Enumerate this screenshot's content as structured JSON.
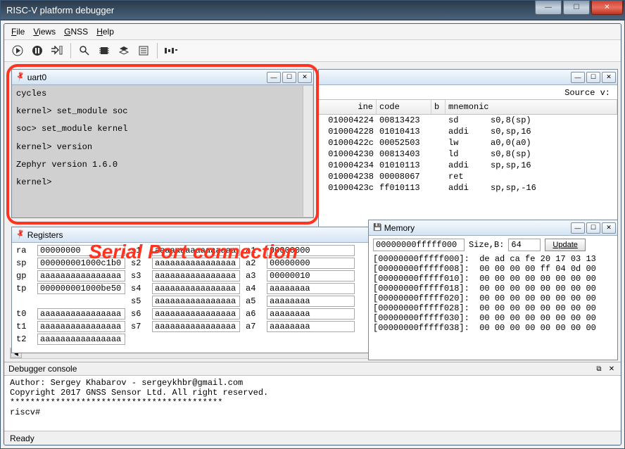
{
  "window": {
    "title": "RISC-V platform debugger"
  },
  "menu": {
    "file": "File",
    "views": "Views",
    "gnss": "GNSS",
    "help": "Help"
  },
  "toolbar_icons": {
    "play": "play-icon",
    "pause": "pause-icon",
    "step": "step-icon",
    "zoom": "search-icon",
    "cpu": "cpu-icon",
    "layers": "layers-icon",
    "list": "list-icon",
    "signal": "signal-icon"
  },
  "uart": {
    "title": "uart0",
    "lines": [
      "cycles",
      "",
      "kernel> set_module soc",
      "",
      "soc> set_module kernel",
      "",
      "kernel> version",
      "",
      "Zephyr version 1.6.0",
      "",
      "kernel>"
    ]
  },
  "source": {
    "heading": "Source v:",
    "cols": {
      "line": "ine",
      "code": "code",
      "b": "b",
      "mnemonic": "mnemonic"
    },
    "rows": [
      {
        "addr": "010004224",
        "code": "00813423",
        "mn": "sd",
        "op": "s0,8(sp)"
      },
      {
        "addr": "010004228",
        "code": "01010413",
        "mn": "addi",
        "op": "s0,sp,16"
      },
      {
        "addr": "01000422c",
        "code": "00052503",
        "mn": "lw",
        "op": "a0,0(a0)"
      },
      {
        "addr": "010004230",
        "code": "00813403",
        "mn": "ld",
        "op": "s0,8(sp)"
      },
      {
        "addr": "010004234",
        "code": "01010113",
        "mn": "addi",
        "op": "sp,sp,16"
      },
      {
        "addr": "010004238",
        "code": "00008067",
        "mn": "ret",
        "op": ""
      },
      {
        "addr": "01000423c",
        "code": "ff010113",
        "mn": "addi",
        "op": "sp,sp,-16"
      }
    ]
  },
  "registers": {
    "title": "Registers",
    "rows1": [
      {
        "n": "ra",
        "v": "00000000"
      },
      {
        "n": "sp",
        "v": "000000001000c1b0"
      },
      {
        "n": "gp",
        "v": "aaaaaaaaaaaaaaaa"
      },
      {
        "n": "tp",
        "v": "000000001000be50"
      }
    ],
    "rows2": [
      {
        "n": "t0",
        "v": "aaaaaaaaaaaaaaaa"
      },
      {
        "n": "t1",
        "v": "aaaaaaaaaaaaaaaa"
      },
      {
        "n": "t2",
        "v": "aaaaaaaaaaaaaaaa"
      }
    ],
    "mid1": [
      {
        "n": "s1",
        "v": "aaaaaaaaaaaaaaaa"
      },
      {
        "n": "s2",
        "v": "aaaaaaaaaaaaaaaa"
      },
      {
        "n": "s3",
        "v": "aaaaaaaaaaaaaaaa"
      },
      {
        "n": "s4",
        "v": "aaaaaaaaaaaaaaaa"
      },
      {
        "n": "s5",
        "v": "aaaaaaaaaaaaaaaa"
      },
      {
        "n": "s6",
        "v": "aaaaaaaaaaaaaaaa"
      },
      {
        "n": "s7",
        "v": "aaaaaaaaaaaaaaaa"
      }
    ],
    "right1": [
      {
        "n": "a1",
        "v": "00000000"
      },
      {
        "n": "a2",
        "v": "00000000"
      },
      {
        "n": "a3",
        "v": "00000010"
      },
      {
        "n": "a4",
        "v": "aaaaaaaa"
      },
      {
        "n": "a5",
        "v": "aaaaaaaa"
      },
      {
        "n": "a6",
        "v": "aaaaaaaa"
      },
      {
        "n": "a7",
        "v": "aaaaaaaa"
      }
    ]
  },
  "memory": {
    "title": "Memory",
    "addr": "00000000fffff000",
    "size_label": "Size,B:",
    "size": "64",
    "update": "Update",
    "rows": [
      "[00000000fffff000]:  de ad ca fe 20 17 03 13",
      "[00000000fffff008]:  00 00 00 00 ff 04 0d 00",
      "[00000000fffff010]:  00 00 00 00 00 00 00 00",
      "[00000000fffff018]:  00 00 00 00 00 00 00 00",
      "[00000000fffff020]:  00 00 00 00 00 00 00 00",
      "[00000000fffff028]:  00 00 00 00 00 00 00 00",
      "[00000000fffff030]:  00 00 00 00 00 00 00 00",
      "[00000000fffff038]:  00 00 00 00 00 00 00 00"
    ]
  },
  "console": {
    "title": "Debugger console",
    "lines": [
      "  Author: Sergey Khabarov - sergeykhbr@gmail.com",
      "  Copyright 2017 GNSS Sensor Ltd. All right reserved.",
      "******************************************",
      "riscv#"
    ]
  },
  "status": "Ready",
  "annotation": "Serial Port connection"
}
